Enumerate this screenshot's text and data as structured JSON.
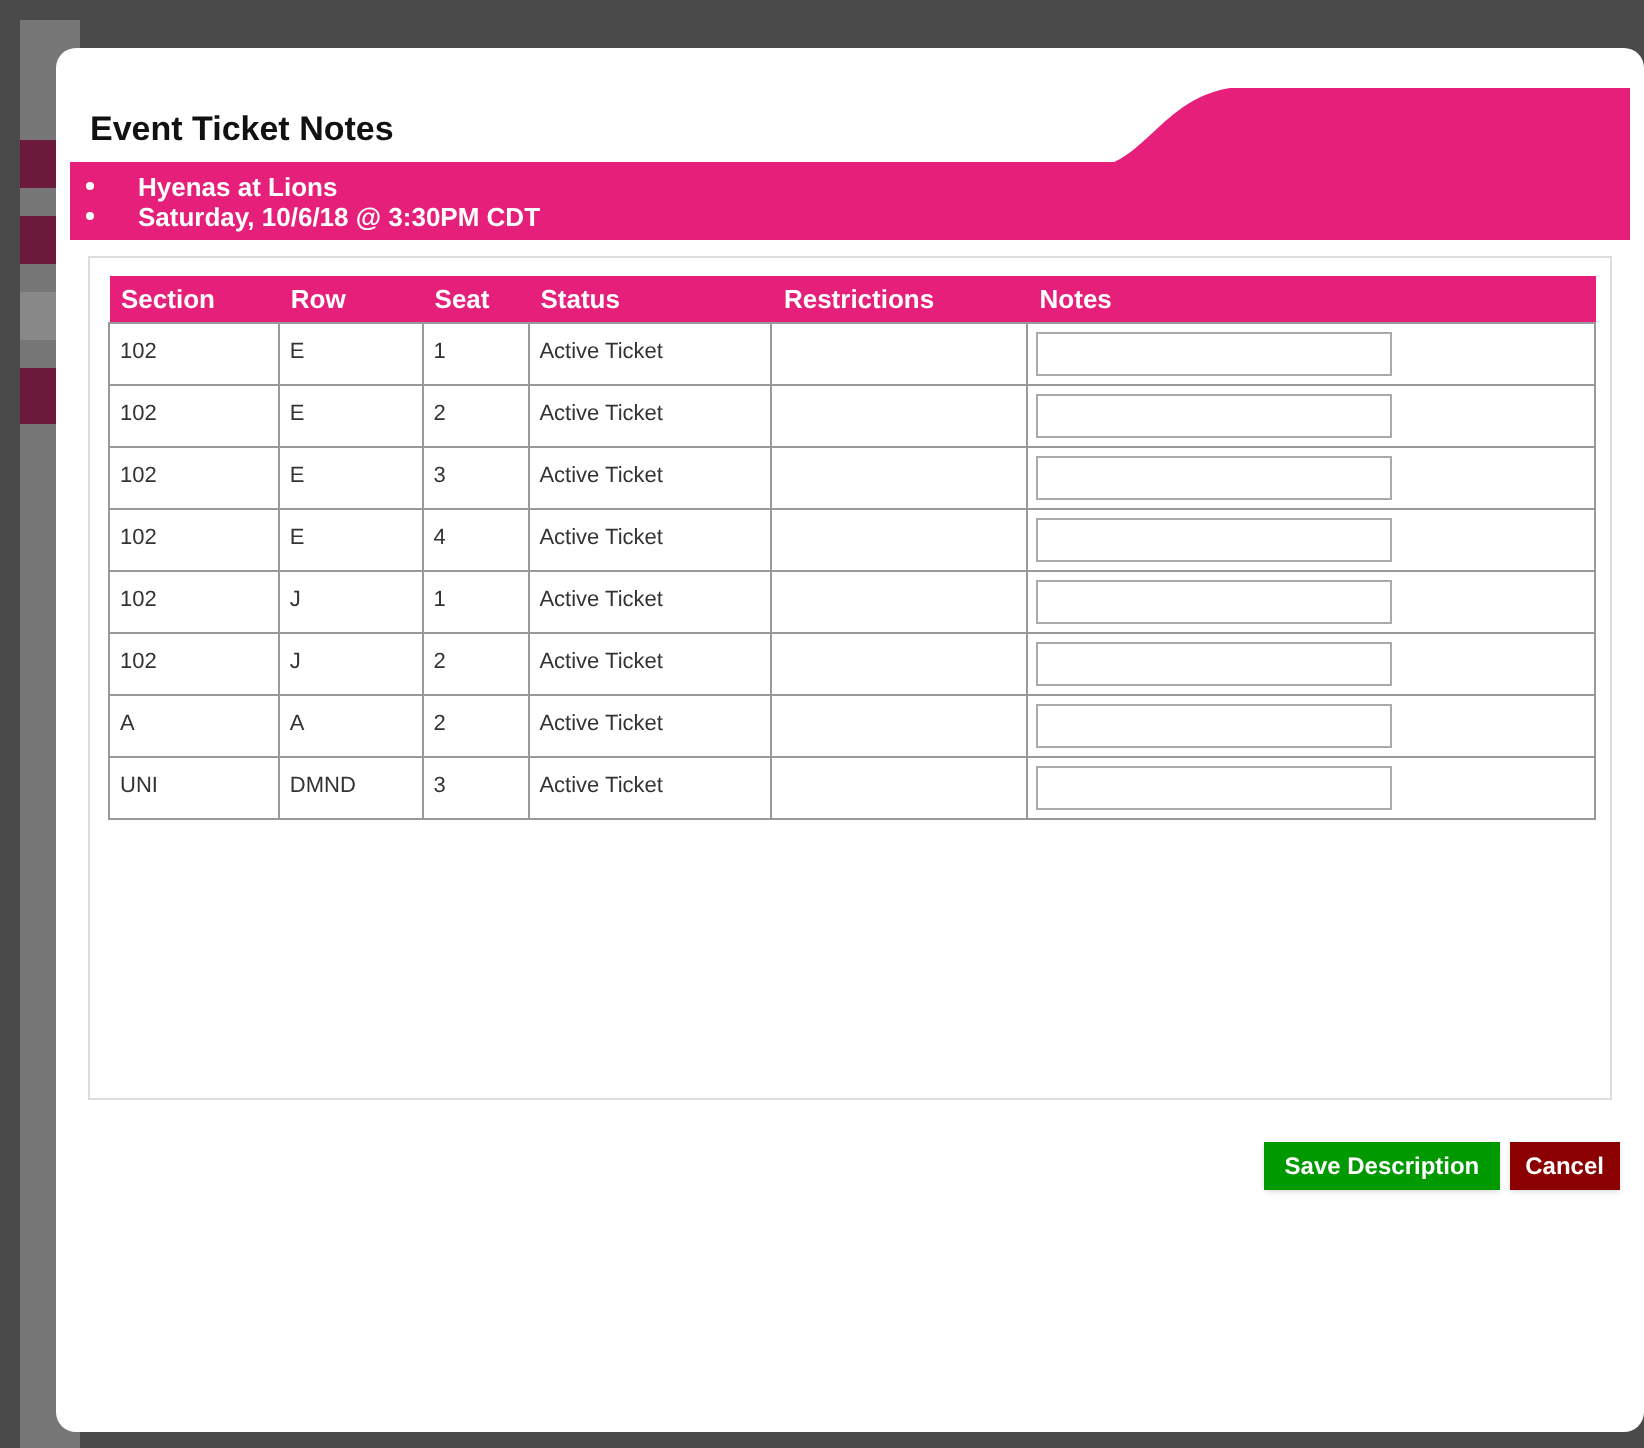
{
  "dialog": {
    "title": "Event Ticket Notes",
    "event_lines": [
      "Hyenas at Lions",
      "Saturday, 10/6/18 @ 3:30PM CDT"
    ]
  },
  "table": {
    "columns": [
      "Section",
      "Row",
      "Seat",
      "Status",
      "Restrictions",
      "Notes"
    ],
    "rows": [
      {
        "section": "102",
        "row": "E",
        "seat": "1",
        "status": "Active Ticket"
      },
      {
        "section": "102",
        "row": "E",
        "seat": "2",
        "status": "Active Ticket"
      },
      {
        "section": "102",
        "row": "E",
        "seat": "3",
        "status": "Active Ticket"
      },
      {
        "section": "102",
        "row": "E",
        "seat": "4",
        "status": "Active Ticket"
      },
      {
        "section": "102",
        "row": "J",
        "seat": "1",
        "status": "Active Ticket"
      },
      {
        "section": "102",
        "row": "J",
        "seat": "2",
        "status": "Active Ticket"
      },
      {
        "section": "A",
        "row": "A",
        "seat": "2",
        "status": "Active Ticket"
      },
      {
        "section": "UNI",
        "row": "DMND",
        "seat": "3",
        "status": "Active Ticket"
      }
    ]
  },
  "buttons": {
    "save": "Save Description",
    "cancel": "Cancel"
  }
}
